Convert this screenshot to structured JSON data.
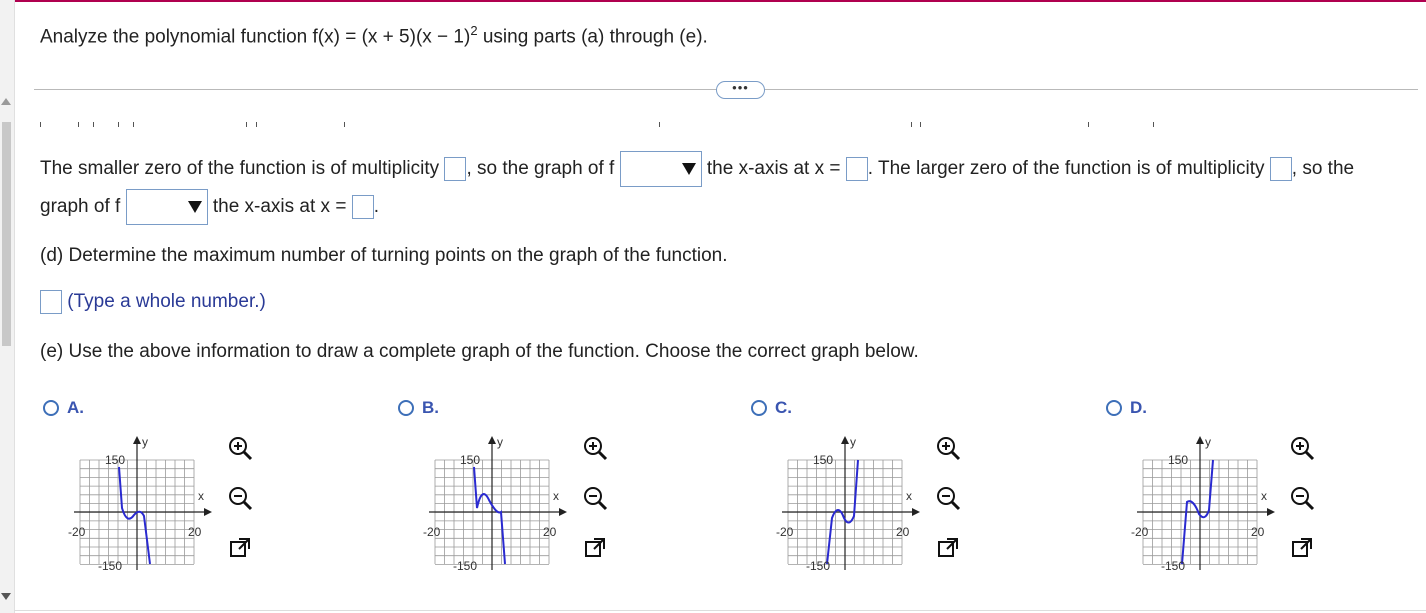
{
  "question": {
    "prefix": "Analyze the polynomial function f(x) = (x + 5)(x − 1)",
    "exponent": "2",
    "suffix": " using parts (a) through (e)."
  },
  "more_button": "•••",
  "multiplicity_sentence": {
    "part1": "The smaller zero of the function is of multiplicity",
    "part2": ", so the graph of f",
    "part3": "the x-axis at x =",
    "part4": ". The larger zero of the function is of multiplicity",
    "part5": ", so the",
    "part6": "graph of f",
    "part7": "the x-axis at x =",
    "part8": "."
  },
  "part_d": {
    "text": "(d) Determine the maximum number of turning points on the graph of the function.",
    "hint": "(Type a whole number.)"
  },
  "part_e": {
    "text": "(e) Use the above information to draw a complete graph of the function. Choose the correct graph below."
  },
  "options": [
    {
      "label": "A.",
      "ytop": "150",
      "ybottom": "-150",
      "xleft": "-20",
      "xright": "20",
      "xaxis": "x",
      "yaxis": "y",
      "curve": "A"
    },
    {
      "label": "B.",
      "ytop": "150",
      "ybottom": "-150",
      "xleft": "-20",
      "xright": "20",
      "xaxis": "x",
      "yaxis": "y",
      "curve": "B"
    },
    {
      "label": "C.",
      "ytop": "150",
      "ybottom": "-150",
      "xleft": "-20",
      "xright": "20",
      "xaxis": "x",
      "yaxis": "y",
      "curve": "C"
    },
    {
      "label": "D.",
      "ytop": "150",
      "ybottom": "-150",
      "xleft": "-20",
      "xright": "20",
      "xaxis": "x",
      "yaxis": "y",
      "curve": "D"
    }
  ],
  "icons": [
    "zoom-in-icon",
    "zoom-out-icon",
    "open-external-icon"
  ],
  "colors": {
    "accent": "#3a55b0",
    "curve": "#2a2ad0",
    "border": "#7a9cc7",
    "top_bar": "#b0004f"
  }
}
